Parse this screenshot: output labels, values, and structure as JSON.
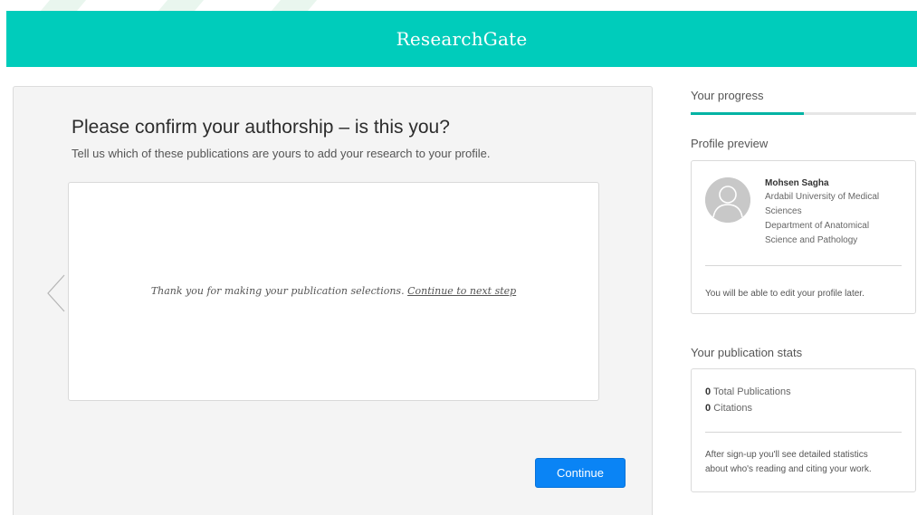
{
  "header": {
    "brand": "ResearchGate"
  },
  "main": {
    "title": "Please confirm your authorship – is this you?",
    "subtitle": "Tell us which of these publications are yours to add your research to your profile.",
    "message_text": "Thank you for making your publication selections.",
    "message_link": "Continue to next step",
    "continue_label": "Continue"
  },
  "sidebar": {
    "progress_label": "Your progress",
    "progress_fraction": 0.5,
    "profile_preview": {
      "heading": "Profile preview",
      "name": "Mohsen Sagha",
      "affiliation_lines": [
        "Ardabil University of Medical",
        "Sciences",
        "Department of Anatomical",
        "Science and Pathology"
      ],
      "note": "You will be able to edit your profile later."
    },
    "publication_stats": {
      "heading": "Your publication stats",
      "total_publications_value": "0",
      "total_publications_label": "Total Publications",
      "citations_value": "0",
      "citations_label": "Citations",
      "note_lines": [
        "After sign-up you'll see detailed statistics",
        "about who's reading and citing your work."
      ]
    }
  },
  "colors": {
    "brand": "#00ccbb",
    "progress": "#00b3a4",
    "button": "#0a84f5"
  },
  "icons": {
    "carousel_prev": "chevron-left-icon",
    "avatar": "default-avatar-icon"
  }
}
